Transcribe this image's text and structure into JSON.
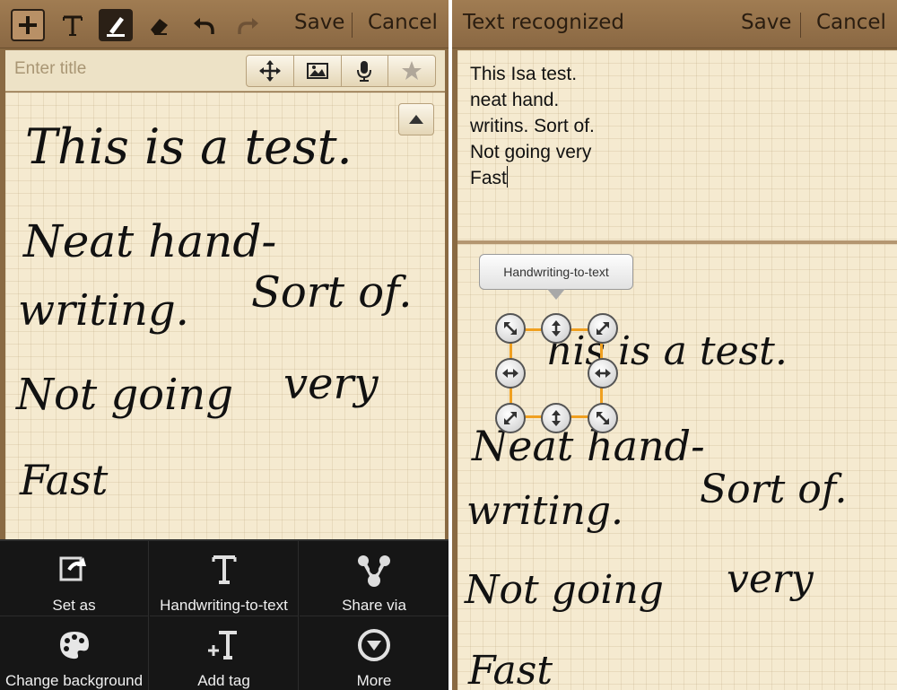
{
  "left_toolbar": {
    "save_label": "Save",
    "cancel_label": "Cancel",
    "tools": [
      "add-icon",
      "text-tool-icon",
      "pen-tool-icon",
      "eraser-icon",
      "undo-icon",
      "redo-icon"
    ]
  },
  "title_bar": {
    "placeholder": "Enter title",
    "tools": [
      "move-icon",
      "image-icon",
      "microphone-icon",
      "star-icon"
    ]
  },
  "left_handwriting": {
    "line1": "This is a test.",
    "line2": "Neat hand-",
    "line3a": "writing.",
    "line3b": "Sort of.",
    "line4a": "Not going",
    "line4b": "very",
    "line5": "Fast"
  },
  "menu": {
    "items": [
      {
        "label": "Set as",
        "icon": "set-as-icon"
      },
      {
        "label": "Handwriting-to-text",
        "icon": "handwriting-text-icon"
      },
      {
        "label": "Share via",
        "icon": "share-icon"
      },
      {
        "label": "Change background",
        "icon": "palette-icon"
      },
      {
        "label": "Add tag",
        "icon": "add-tag-icon"
      },
      {
        "label": "More",
        "icon": "more-icon"
      }
    ]
  },
  "right_toolbar": {
    "title": "Text recognized",
    "save_label": "Save",
    "cancel_label": "Cancel"
  },
  "recognized": {
    "lines": [
      "This Isa test.",
      "neat hand.",
      "writins. Sort of.",
      "Not going very",
      "Fast"
    ]
  },
  "tooltip": {
    "label": "Handwriting-to-text"
  },
  "right_handwriting": {
    "line1": "his is a test.",
    "line2": "Neat hand-",
    "line3a": "writing.",
    "line3b": "Sort of.",
    "line4a": "Not going",
    "line4b": "very",
    "line5": "Fast"
  },
  "colors": {
    "wood": "#8a6a43",
    "paper": "#f5ead0",
    "selection": "#f0a020",
    "menu_bg": "#161616"
  }
}
